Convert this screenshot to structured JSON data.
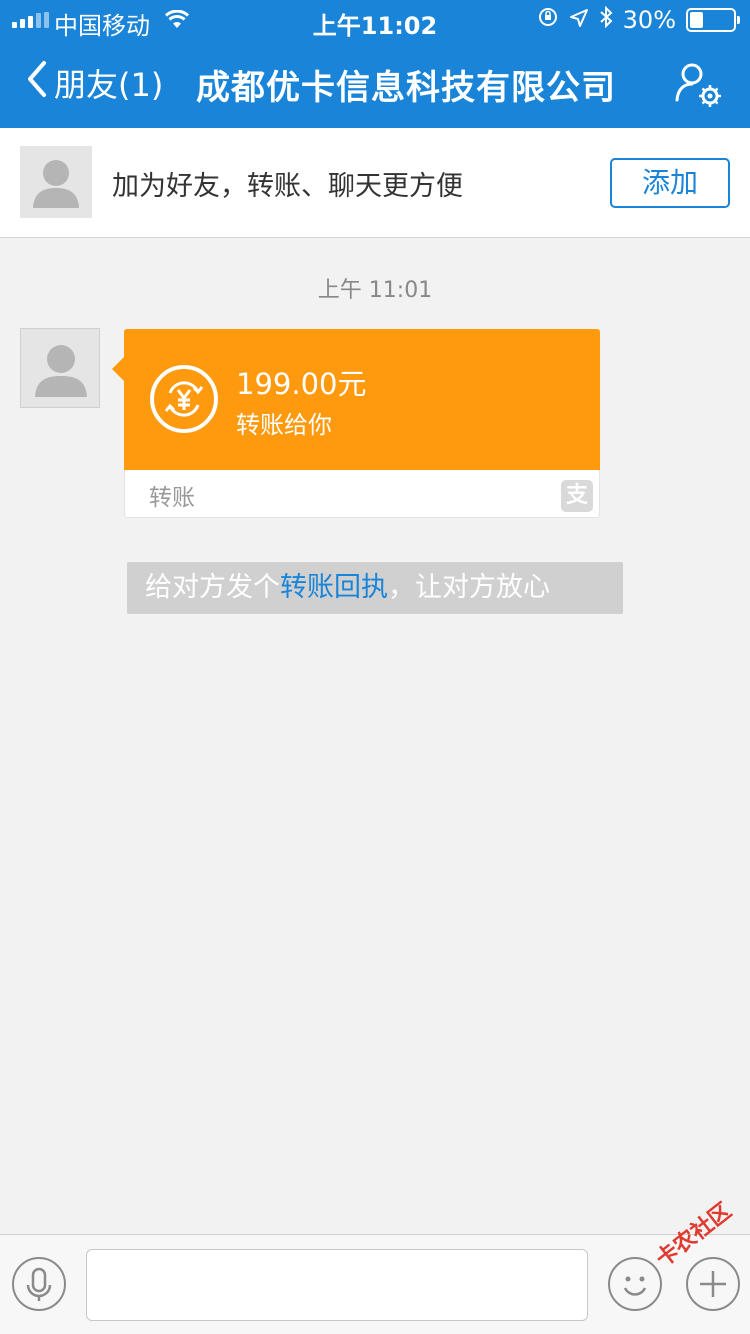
{
  "status_bar": {
    "carrier": "中国移动",
    "time": "上午11:02",
    "battery_text": "30%",
    "battery_level": 0.3
  },
  "nav": {
    "back_label": "朋友(1)",
    "title": "成都优卡信息科技有限公司"
  },
  "add_friend_banner": {
    "text": "加为好友，转账、聊天更方便",
    "button_label": "添加"
  },
  "chat": {
    "timestamp": "上午 11:01",
    "transfer": {
      "amount": "199.00元",
      "subtitle": "转账给你",
      "footer_label": "转账",
      "alipay_glyph": "支"
    },
    "hint": {
      "prefix": "给对方发个",
      "link": "转账回执",
      "suffix": "，让对方放心"
    }
  },
  "input_bar": {
    "placeholder": ""
  },
  "watermark": "卡农社区",
  "colors": {
    "nav_blue": "#1a84d8",
    "transfer_orange": "#ff9a0e",
    "background": "#f2f2f2"
  },
  "icons": {
    "back": "chevron-left-icon",
    "profile": "profile-settings-icon",
    "transfer": "yuan-transfer-icon",
    "voice": "microphone-icon",
    "emoji": "smiley-icon",
    "more": "plus-icon"
  }
}
